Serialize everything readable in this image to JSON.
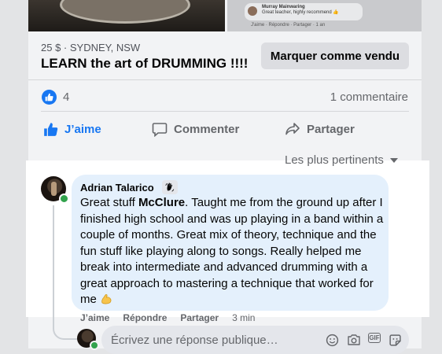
{
  "listing": {
    "meta": "25 $ · SYDNEY, NSW",
    "title": "LEARN the art of DRUMMING !!!!",
    "mark_sold_label": "Marquer comme vendu",
    "preview_comment_author": "Murray Mainwaring",
    "preview_comment_text": "Great teacher, highly recommend 👍",
    "preview_comment_actions": "J'aime · Répondre · Partager · 1 an"
  },
  "reactions": {
    "like_count": "4",
    "comment_count": "1 commentaire"
  },
  "actions": {
    "like_label": "J’aime",
    "comment_label": "Commenter",
    "share_label": "Partager"
  },
  "sort": {
    "label": "Les plus pertinents"
  },
  "comment": {
    "author": "Adrian Talarico",
    "text_before": "Great stuff ",
    "mention": "McClure",
    "text_after": ". Taught me from the ground up after I finished high school and was up playing in a band within a couple of months. Great mix of theory, technique and the fun stuff like playing along to songs. Really helped me break into intermediate and advanced drumming with a great approach to mastering a technique that worked for me",
    "like_label": "J’aime",
    "reply_label": "Répondre",
    "share_label": "Partager",
    "time": "3 min"
  },
  "reply": {
    "placeholder": "Écrivez une réponse publique…"
  },
  "colors": {
    "accent": "#1877f2",
    "bubble": "#e4f0fc",
    "online": "#31a24c"
  },
  "icons": [
    "thumbs-up-icon",
    "comment-icon",
    "share-icon",
    "chevron-down-icon",
    "wave-badge-icon",
    "flexed-arm-emoji-icon",
    "smiley-icon",
    "camera-icon",
    "gif-icon",
    "sticker-icon"
  ]
}
